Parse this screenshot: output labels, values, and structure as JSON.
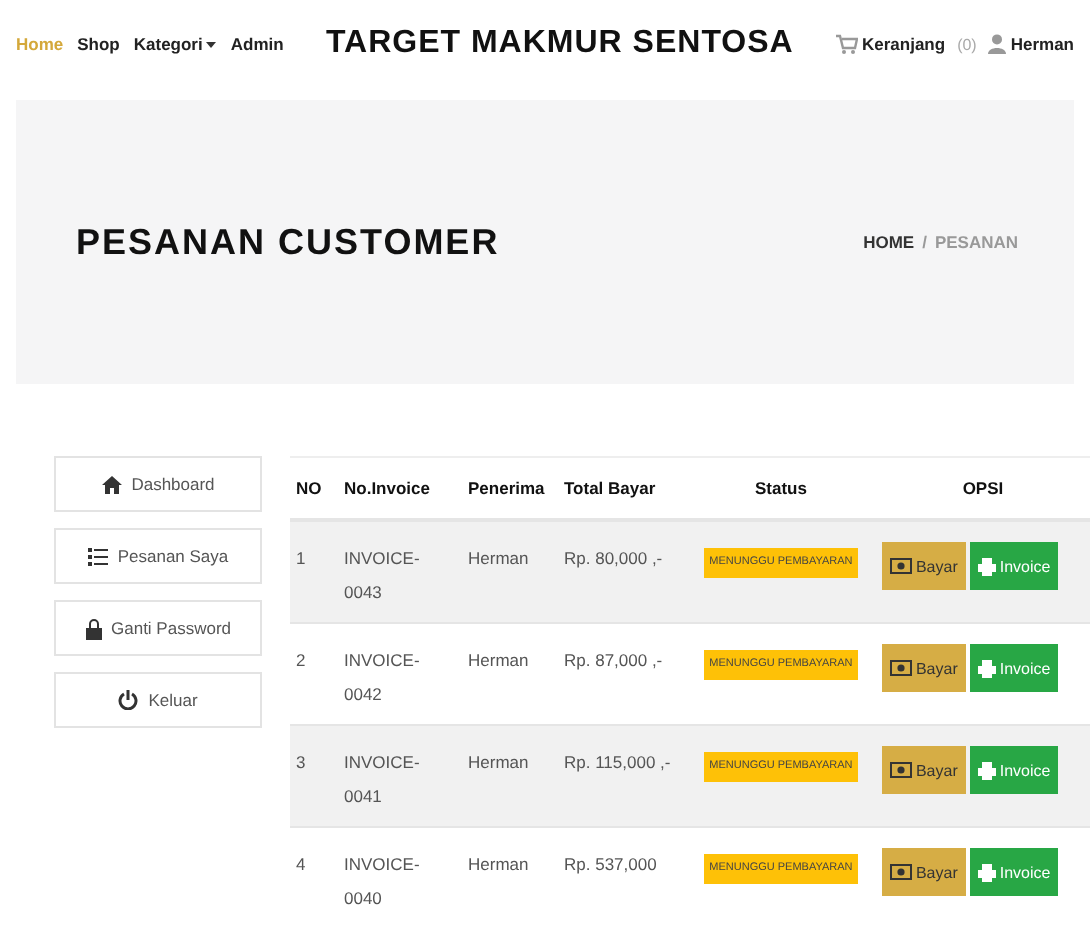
{
  "nav": {
    "items": [
      {
        "label": "Home",
        "selected": true,
        "kind": "link"
      },
      {
        "label": "Shop",
        "selected": false,
        "kind": "link"
      },
      {
        "label": "Kategori",
        "selected": false,
        "kind": "dropdown"
      },
      {
        "label": "Admin",
        "selected": false,
        "kind": "link"
      }
    ],
    "brand": "TARGET MAKMUR SENTOSA",
    "cart": {
      "label": "Keranjang",
      "count": "(0)"
    },
    "user": "Herman"
  },
  "banner": {
    "title": "PESANAN CUSTOMER",
    "breadcrumb": [
      "HOME",
      "/",
      "PESANAN"
    ]
  },
  "sidebar": {
    "items": [
      {
        "label": "Dashboard",
        "kind": "home"
      },
      {
        "label": "Pesanan Saya",
        "kind": "list"
      },
      {
        "label": "Ganti Password",
        "kind": "lock"
      },
      {
        "label": "Keluar",
        "kind": "power"
      }
    ]
  },
  "table": {
    "columns": [
      "NO",
      "No.Invoice",
      "Penerima",
      "Total Bayar",
      "Status",
      "OPSI"
    ],
    "rows": [
      {
        "no": "1",
        "invoice": "INVOICE-0043",
        "penerima": "Herman",
        "total": "Rp. 80,000 ,-",
        "status": "MENUNGGU PEMBAYARAN",
        "actions": [
          "Bayar",
          "Invoice"
        ]
      },
      {
        "no": "2",
        "invoice": "INVOICE-0042",
        "penerima": "Herman",
        "total": "Rp. 87,000 ,-",
        "status": "MENUNGGU PEMBAYARAN",
        "actions": [
          "Bayar",
          "Invoice"
        ]
      },
      {
        "no": "3",
        "invoice": "INVOICE-0041",
        "penerima": "Herman",
        "total": "Rp. 115,000 ,-",
        "status": "MENUNGGU PEMBAYARAN",
        "actions": [
          "Bayar",
          "Invoice"
        ]
      },
      {
        "no": "4",
        "invoice": "INVOICE-0040",
        "penerima": "Herman",
        "total": "Rp. 537,000",
        "status": "MENUNGGU PEMBAYARAN",
        "actions": [
          "Bayar",
          "Invoice"
        ]
      }
    ]
  }
}
